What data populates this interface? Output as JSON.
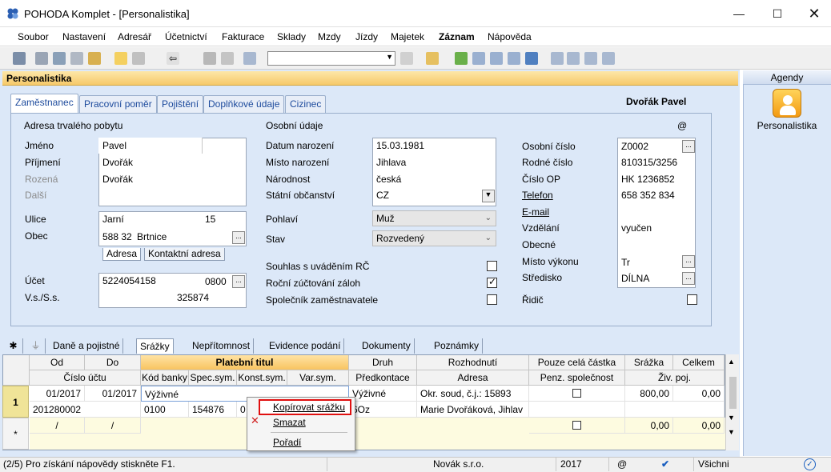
{
  "window": {
    "title": "POHODA Komplet - [Personalistika]"
  },
  "menu": [
    "Soubor",
    "Nastavení",
    "Adresář",
    "Účetnictví",
    "Fakturace",
    "Sklady",
    "Mzdy",
    "Jízdy",
    "Majetek",
    "Záznam",
    "Nápověda"
  ],
  "module_title": "Personalistika",
  "agendy": {
    "header": "Agendy",
    "item_label": "Personalistika"
  },
  "tabs": [
    "Zaměstnanec",
    "Pracovní poměr",
    "Pojištění",
    "Doplňkové údaje",
    "Cizinec"
  ],
  "employee_name": "Dvořák Pavel",
  "at_symbol": "@",
  "address": {
    "section_title": "Adresa trvalého pobytu",
    "labels": {
      "jmeno": "Jméno",
      "prijmeni": "Příjmení",
      "rozena": "Rozená",
      "dalsi": "Další",
      "ulice": "Ulice",
      "obec": "Obec",
      "ucet": "Účet",
      "vss": "V.s./S.s."
    },
    "jmeno": "Pavel",
    "prijmeni": "Dvořák",
    "rozena": "Dvořák",
    "ulice": "Jarní",
    "cislo": "15",
    "psc": "588 32",
    "obec": "Brtnice",
    "subtabs": [
      "Adresa",
      "Kontaktní adresa"
    ],
    "ucet": "5224054158",
    "kod_banky": "0800",
    "ss": "325874"
  },
  "personal": {
    "section_title": "Osobní údaje",
    "labels": {
      "datum": "Datum narození",
      "misto": "Místo narození",
      "narodnost": "Národnost",
      "obcanstvi": "Státní občanství",
      "pohlavi": "Pohlaví",
      "stav": "Stav",
      "souhlas": "Souhlas s uváděním RČ",
      "rocni": "Roční zúčtování záloh",
      "spolecnik": "Společník zaměstnavatele"
    },
    "datum": "15.03.1981",
    "misto": "Jihlava",
    "narodnost": "česká",
    "obcanstvi": "CZ",
    "pohlavi": "Muž",
    "stav": "Rozvedený",
    "souhlas_checked": false,
    "rocni_checked": true,
    "spolecnik_checked": false
  },
  "right": {
    "labels": {
      "osobni": "Osobní číslo",
      "rodne": "Rodné číslo",
      "op": "Číslo OP",
      "telefon": "Telefon",
      "email": "E-mail",
      "vzdelani": "Vzdělání",
      "obecne": "Obecné",
      "misto_vykonu": "Místo výkonu",
      "stredisko": "Středisko",
      "ridic": "Řidič"
    },
    "osobni": "Z0002",
    "rodne": "810315/3256",
    "op": "HK 1236852",
    "telefon": "658 352 834",
    "vzdelani": "vyučen",
    "misto_vykonu": "Tr",
    "stredisko": "DÍLNA",
    "ridic_checked": false
  },
  "lower_tabs": [
    "Daně a pojistné",
    "Srážky",
    "Nepřítomnost",
    "Evidence podání",
    "Dokumenty",
    "Poznámky"
  ],
  "grid": {
    "headers_row1": [
      "Od",
      "Do",
      "Platební titul",
      "Druh",
      "Rozhodnutí",
      "Pouze celá částka",
      "Srážka",
      "Celkem"
    ],
    "headers_row2": [
      "Číslo účtu",
      "Kód banky",
      "Spec.sym.",
      "Konst.sym.",
      "Var.sym.",
      "Předkontace",
      "Adresa",
      "Penz. společnost",
      "Živ. poj."
    ],
    "row1": {
      "num": "1",
      "od": "01/2017",
      "do": "01/2017",
      "titul": "Výživné",
      "druh": "Výživné",
      "rozhodnuti": "Okr. soud, č.j.: 15893",
      "srazka": "800,00",
      "celkem": "0,00",
      "ucet": "201280002",
      "kod": "0100",
      "spec": "154876",
      "konst": "0",
      "predkontace": "6Oz",
      "adresa": "Marie Dvořáková, Jihlav"
    },
    "new_row": {
      "marker": "*",
      "od": "/",
      "do": "/",
      "srazka": "0,00",
      "celkem": "0,00"
    }
  },
  "context_menu": [
    "Kopírovat srážku",
    "Smazat",
    "Pořadí"
  ],
  "status": {
    "help": "(2/5) Pro získání nápovědy stiskněte F1.",
    "company": "Novák s.r.o.",
    "year": "2017",
    "at": "@",
    "filter": "Všichni"
  }
}
